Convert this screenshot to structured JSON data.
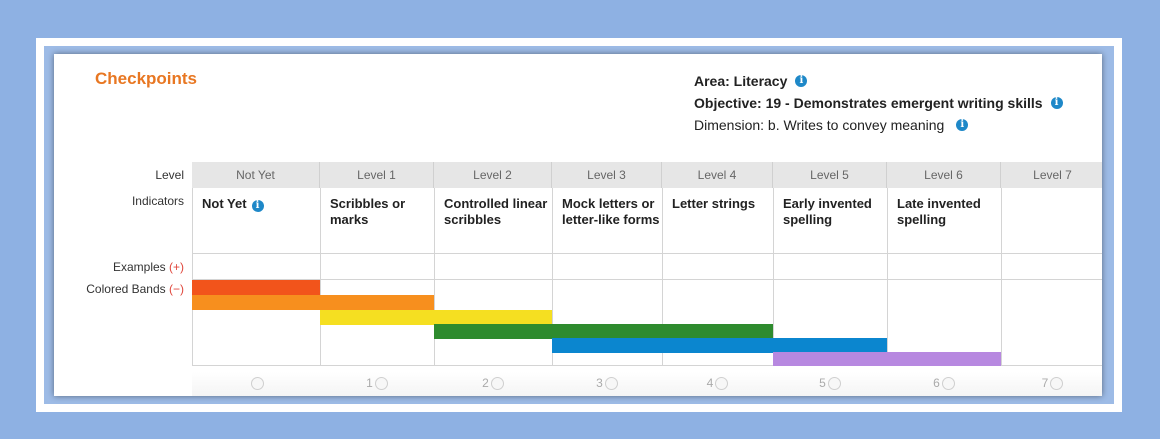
{
  "header": {
    "title": "Checkpoints",
    "area": "Area: Literacy",
    "objective": "Objective: 19 - Demonstrates emergent writing skills",
    "dimension": "Dimension: b. Writes to convey meaning"
  },
  "row_labels": {
    "level": "Level",
    "indicators": "Indicators",
    "examples": "Examples",
    "examples_toggle": "(+)",
    "colored_bands": "Colored Bands",
    "colored_bands_toggle": "(−)"
  },
  "levels": [
    "Not Yet",
    "Level 1",
    "Level 2",
    "Level 3",
    "Level 4",
    "Level 5",
    "Level 6",
    "Level 7"
  ],
  "indicators": [
    "Not Yet",
    "Scribbles or marks",
    "Controlled linear scribbles",
    "Mock letters or letter-like forms",
    "Letter strings",
    "Early invented spelling",
    "Late invented spelling",
    ""
  ],
  "rating_numbers": [
    "",
    "1",
    "2",
    "3",
    "4",
    "5",
    "6",
    "7"
  ],
  "colors": {
    "red": "#f2541b",
    "orange": "#f78f1e",
    "yellow": "#f5df21",
    "green": "#2e8b2e",
    "blue": "#0b86cf",
    "purple": "#b788e0",
    "title": "#e87722",
    "info_icon": "#1e88c8"
  },
  "icons": {
    "info": "info-icon",
    "radio": "radio-button"
  }
}
